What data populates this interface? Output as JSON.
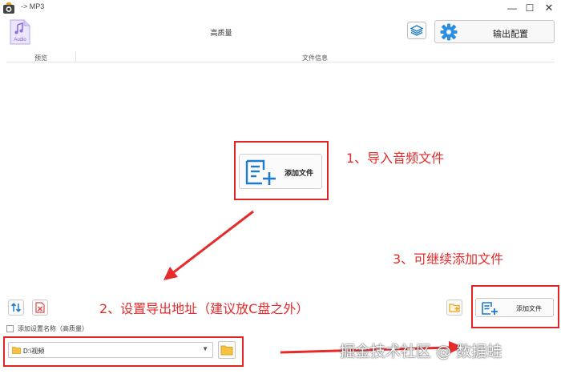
{
  "window": {
    "title": "-> MP3",
    "minimize": "—",
    "maximize": "☐",
    "close": "✕"
  },
  "header": {
    "thumb_label": "Audio",
    "preset_name": "高质量",
    "output_config_label": "输出配置"
  },
  "columns": {
    "preview": "预览",
    "file_info": "文件信息"
  },
  "center": {
    "add_file_label": "添加文件"
  },
  "annotations": {
    "step1": "1、导入音频文件",
    "step2": "2、设置导出地址（建议放C盘之外）",
    "step3": "3、可继续添加文件"
  },
  "bottom": {
    "add_file_label": "添加文件",
    "append_setting_label": "添加设置名称（高质量）",
    "output_path": "D:\\视频",
    "dropdown_caret": "▼"
  },
  "watermark": "掘金技术社区 @ 数据蛙",
  "colors": {
    "annotation_red": "#e52b2b",
    "icon_blue": "#1f7ac9"
  }
}
